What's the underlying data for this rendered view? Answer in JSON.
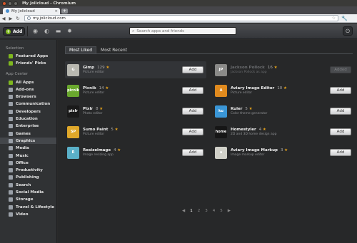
{
  "window": {
    "title": "My Jolicloud - Chromium"
  },
  "browser": {
    "tab_title": "My Jolicloud",
    "tab_close": "×",
    "new_tab": "+",
    "url": "my.jolicloud.com",
    "back": "◀",
    "forward": "▶",
    "reload": "↻",
    "bookmark": "☆",
    "menu": "🔧"
  },
  "topbar": {
    "add_label": "Add",
    "add_plus": "+",
    "search_placeholder": "Search apps and friends",
    "search_icon": "⌕",
    "icons": [
      "home-icon",
      "support-icon",
      "storage-icon",
      "settings-icon"
    ],
    "power": "⏻"
  },
  "sidebar": {
    "selection_header": "Selection",
    "selection": [
      "Featured Apps",
      "Friends' Picks"
    ],
    "center_header": "App Center",
    "categories": [
      "All Apps",
      "Add-ons",
      "Browsers",
      "Communication",
      "Developers",
      "Education",
      "Enterprise",
      "Games",
      "Graphics",
      "Media",
      "Music",
      "Office",
      "Productivity",
      "Publishing",
      "Search",
      "Social Media",
      "Storage",
      "Travel & Lifestyle",
      "Video"
    ],
    "active_category": "Graphics"
  },
  "main": {
    "tabs": [
      "Most Liked",
      "Most Recent"
    ],
    "active_tab": "Most Liked",
    "add_label": "Add",
    "added_label": "Added",
    "apps": [
      {
        "name": "Gimp",
        "rating": "129",
        "sub": "Picture editor",
        "icon_text": "G",
        "icon_color": "#b8b8b0",
        "state": "add"
      },
      {
        "name": "Jackson Pollock",
        "rating": "16",
        "sub": "Jackson Pollock as app",
        "icon_text": "JP",
        "icon_color": "#8a8a88",
        "state": "added"
      },
      {
        "name": "Picnik",
        "rating": "14",
        "sub": "Picture editor",
        "icon_text": "picnik",
        "icon_color": "#6aa82e",
        "state": "add"
      },
      {
        "name": "Aviary Image Editor",
        "rating": "10",
        "sub": "Picture editor",
        "icon_text": "A",
        "icon_color": "#e08a1e",
        "state": "add"
      },
      {
        "name": "Pixlr",
        "rating": "8",
        "sub": "Photo editor",
        "icon_text": "pixlr",
        "icon_color": "#1a1a1a",
        "state": "add"
      },
      {
        "name": "Kuler",
        "rating": "5",
        "sub": "Color theme generator",
        "icon_text": "ku",
        "icon_color": "#3a96d6",
        "state": "add"
      },
      {
        "name": "Sumo Paint",
        "rating": "5",
        "sub": "Picture editor",
        "icon_text": "SP",
        "icon_color": "#e0a82a",
        "state": "add"
      },
      {
        "name": "Homestyler",
        "rating": "4",
        "sub": "2D and 3D home design app",
        "icon_text": "home",
        "icon_color": "#161616",
        "state": "add"
      },
      {
        "name": "Resizelmage",
        "rating": "4",
        "sub": "Image resizing app",
        "icon_text": "R",
        "icon_color": "#5ab0c8",
        "state": "add"
      },
      {
        "name": "Aviary Image Markup",
        "rating": "3",
        "sub": "Image markup editor",
        "icon_text": "a",
        "icon_color": "#d0d0c8",
        "state": "add"
      }
    ],
    "pager": {
      "prev": "◀",
      "pages": [
        "1",
        "2",
        "3",
        "4",
        "5"
      ],
      "current": "1",
      "next": "▶"
    }
  }
}
